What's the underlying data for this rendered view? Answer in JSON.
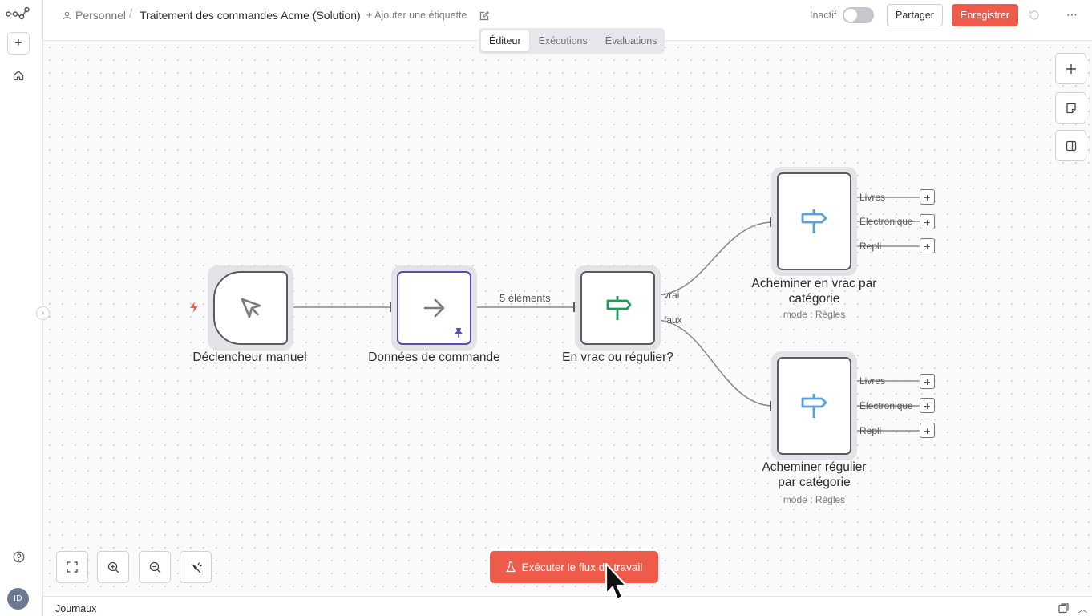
{
  "header": {
    "breadcrumb_personal": "Personnel",
    "breadcrumb_separator": "/",
    "workflow_title": "Traitement des commandes Acme (Solution)",
    "add_tag": "+ Ajouter une étiquette",
    "status_label": "Inactif",
    "share_button": "Partager",
    "save_button": "Enregistrer",
    "more_icon": "⋯"
  },
  "tabs": [
    {
      "label": "Éditeur",
      "active": true
    },
    {
      "label": "Exécutions",
      "active": false
    },
    {
      "label": "Évaluations",
      "active": false
    }
  ],
  "sidebar": {
    "add_icon": "+",
    "avatar_initials": "ID"
  },
  "nodes": {
    "manual_trigger": {
      "label": "Déclencheur manuel",
      "icon": "cursor-click-icon"
    },
    "order_data": {
      "label": "Données de commande",
      "icon": "arrow-right-icon"
    },
    "bulk_or_regular": {
      "label": "En vrac ou régulier?",
      "icon": "signpost-icon",
      "out_true": "vrai",
      "out_false": "faux"
    },
    "route_bulk": {
      "label_line1": "Acheminer en vrac par",
      "label_line2": "catégorie",
      "sub": "mode : Règles",
      "icon": "signpost-icon",
      "outputs": [
        "Livres",
        "Électronique",
        "Repli"
      ]
    },
    "route_regular": {
      "label_line1": "Acheminer régulier",
      "label_line2": "par catégorie",
      "sub": "mode : Règles",
      "icon": "signpost-icon",
      "outputs": [
        "Livres",
        "Électronique",
        "Repli"
      ]
    }
  },
  "edge_label": "5 éléments",
  "run_button": "Exécuter le flux de travail",
  "logs": {
    "label": "Journaux"
  },
  "colors": {
    "accent": "#ef5b4b",
    "node_border": "#5a5a60",
    "pinned": "#5a4ab8",
    "switch_green": "#1f9a5a",
    "switch_blue": "#5aa0d8"
  }
}
